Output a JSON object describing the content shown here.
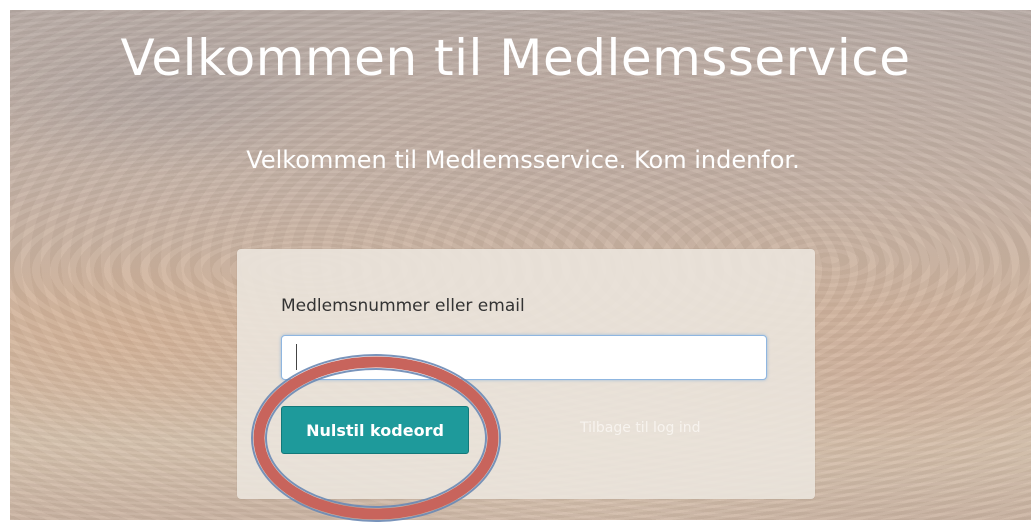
{
  "page": {
    "title": "Velkommen til Medlemsservice",
    "subtitle": "Velkommen til Medlemsservice. Kom indenfor."
  },
  "form": {
    "field_label": "Medlemsnummer eller email",
    "field_value": "",
    "reset_button_label": "Nulstil kodeord",
    "back_link_label": "Tilbage til log ind"
  },
  "colors": {
    "primary_button": "#1e9a9b",
    "annotation_ring": "#c8645c",
    "input_focus": "#8fb6e0"
  },
  "annotation": {
    "shape": "ellipse",
    "target": "reset-button"
  }
}
